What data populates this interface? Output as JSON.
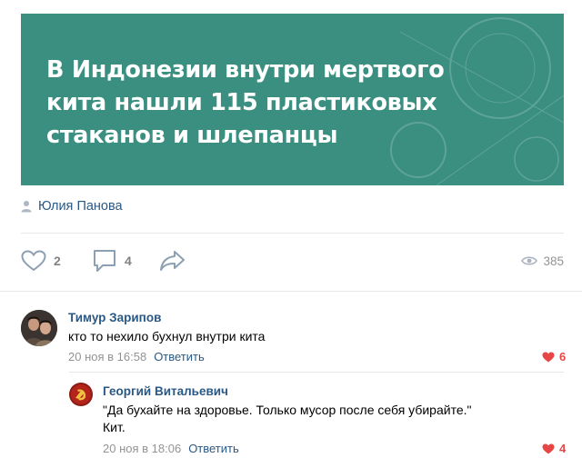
{
  "post": {
    "banner_lines": [
      "В Индонезии внутри мертвого",
      "кита нашли 115 пластиковых",
      "стаканов и шлепанцы"
    ],
    "author": "Юлия Панова",
    "likes": "2",
    "comments": "4",
    "views": "385",
    "banner_color": "#3a8f80"
  },
  "comments": [
    {
      "author": "Тимур Зарипов",
      "text": "кто то нехило бухнул внутри кита",
      "date": "20 ноя в 16:58",
      "reply_label": "Ответить",
      "likes": "6"
    },
    {
      "author": "Георгий Витальевич",
      "text_line1": "\"Да бухайте на здоровье. Только мусор после себя убирайте.\"",
      "text_line2": "Кит.",
      "date": "20 ноя в 18:06",
      "reply_label": "Ответить",
      "likes": "4"
    }
  ],
  "icons": [
    "user-icon",
    "heart-icon",
    "comment-icon",
    "share-icon",
    "eye-icon"
  ],
  "colors": {
    "link": "#2a5885",
    "like_active": "#e64646",
    "muted": "#828282"
  }
}
